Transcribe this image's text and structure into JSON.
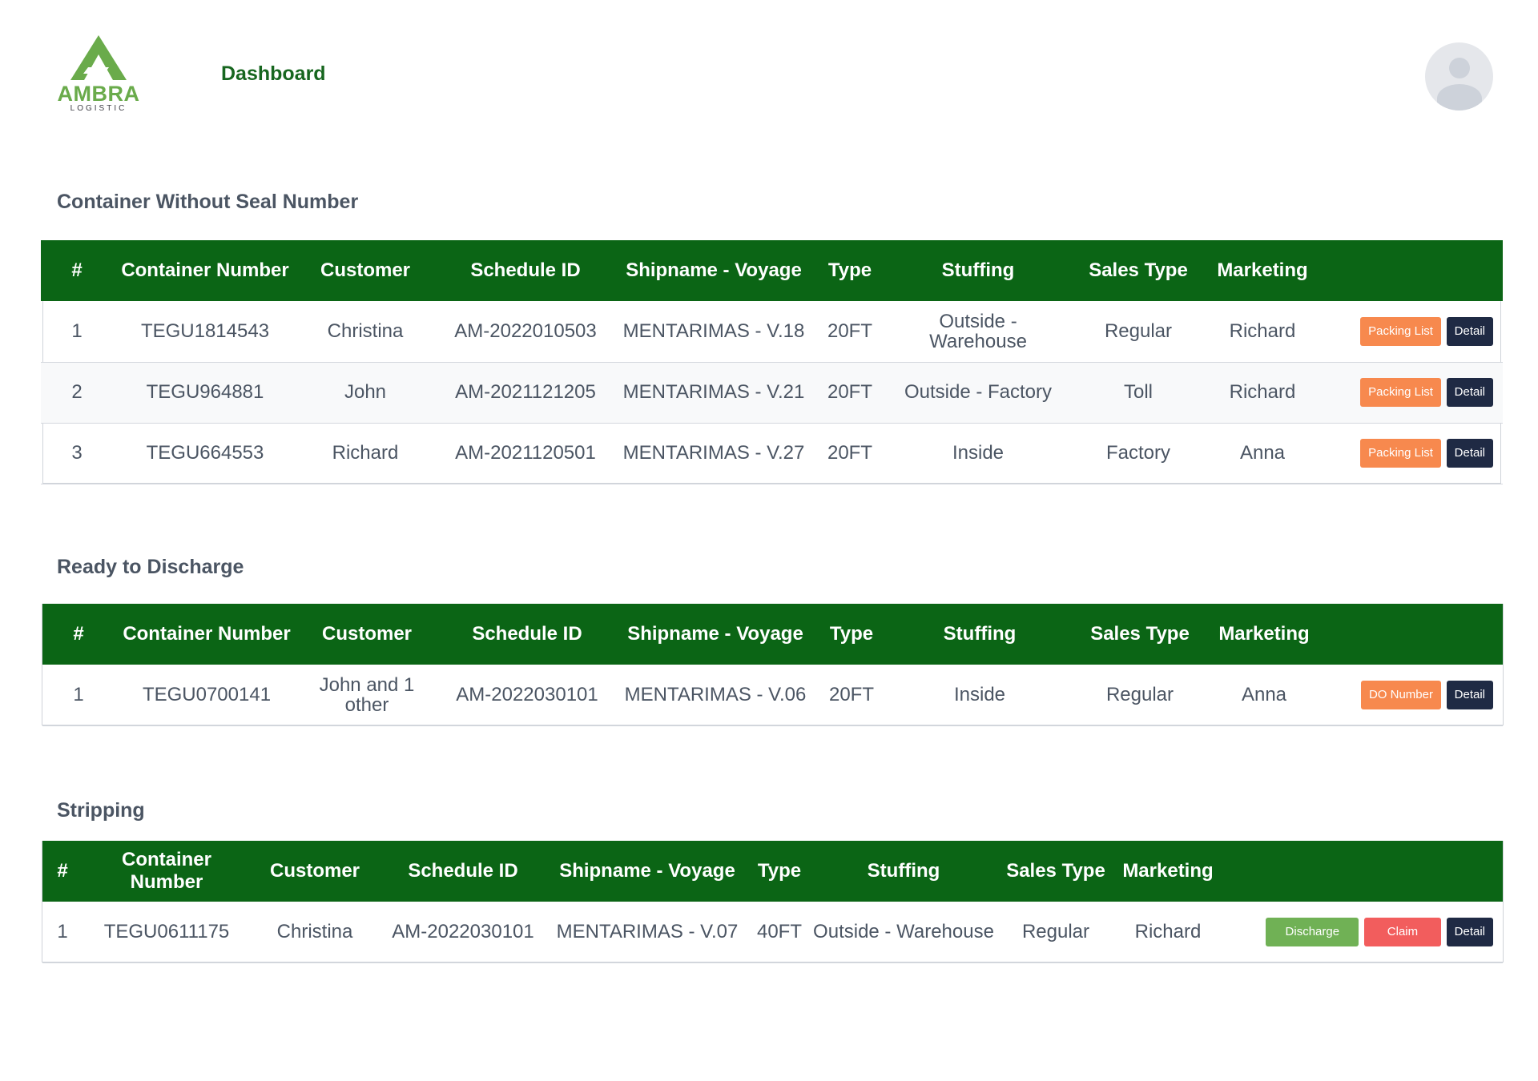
{
  "header": {
    "logo_text": "AMBRA",
    "logo_subtext": "LOGISTIC",
    "nav_dashboard": "Dashboard",
    "avatar_icon": "user-avatar-icon"
  },
  "colors": {
    "brand_green": "#0b6515",
    "logo_green": "#6aab4b",
    "orange": "#f7894e",
    "dark": "#1f2a44",
    "green_button": "#70b155",
    "red_button": "#f25d5d"
  },
  "columns": [
    "#",
    "Container Number",
    "Customer",
    "Schedule ID",
    "Shipname - Voyage",
    "Type",
    "Stuffing",
    "Sales Type",
    "Marketing"
  ],
  "sections": [
    {
      "title": "Container Without Seal Number",
      "rows": [
        {
          "no": "1",
          "container": "TEGU1814543",
          "customer": "Christina",
          "schedule": "AM-2022010503",
          "ship": "MENTARIMAS - V.18",
          "type": "20FT",
          "stuffing": "Outside - Warehouse",
          "sales": "Regular",
          "marketing": "Richard",
          "btn1": "Packing List",
          "btn2": "Detail"
        },
        {
          "no": "2",
          "container": "TEGU964881",
          "customer": "John",
          "schedule": "AM-2021121205",
          "ship": "MENTARIMAS - V.21",
          "type": "20FT",
          "stuffing": "Outside - Factory",
          "sales": "Toll",
          "marketing": "Richard",
          "btn1": "Packing List",
          "btn2": "Detail"
        },
        {
          "no": "3",
          "container": "TEGU664553",
          "customer": "Richard",
          "schedule": "AM-2021120501",
          "ship": "MENTARIMAS - V.27",
          "type": "20FT",
          "stuffing": "Inside",
          "sales": "Factory",
          "marketing": "Anna",
          "btn1": "Packing List",
          "btn2": "Detail"
        }
      ]
    },
    {
      "title": "Ready to Discharge",
      "rows": [
        {
          "no": "1",
          "container": "TEGU0700141",
          "customer": "John and 1 other",
          "schedule": "AM-2022030101",
          "ship": "MENTARIMAS - V.06",
          "type": "20FT",
          "stuffing": "Inside",
          "sales": "Regular",
          "marketing": "Anna",
          "btn1": "DO Number",
          "btn2": "Detail"
        }
      ]
    },
    {
      "title": "Stripping",
      "rows": [
        {
          "no": "1",
          "container": "TEGU0611175",
          "customer": "Christina",
          "schedule": "AM-2022030101",
          "ship": "MENTARIMAS - V.07",
          "type": "40FT",
          "stuffing": "Outside - Warehouse",
          "sales": "Regular",
          "marketing": "Richard",
          "btn1": "Discharge",
          "btn2": "Claim",
          "btn3": "Detail"
        }
      ]
    }
  ]
}
